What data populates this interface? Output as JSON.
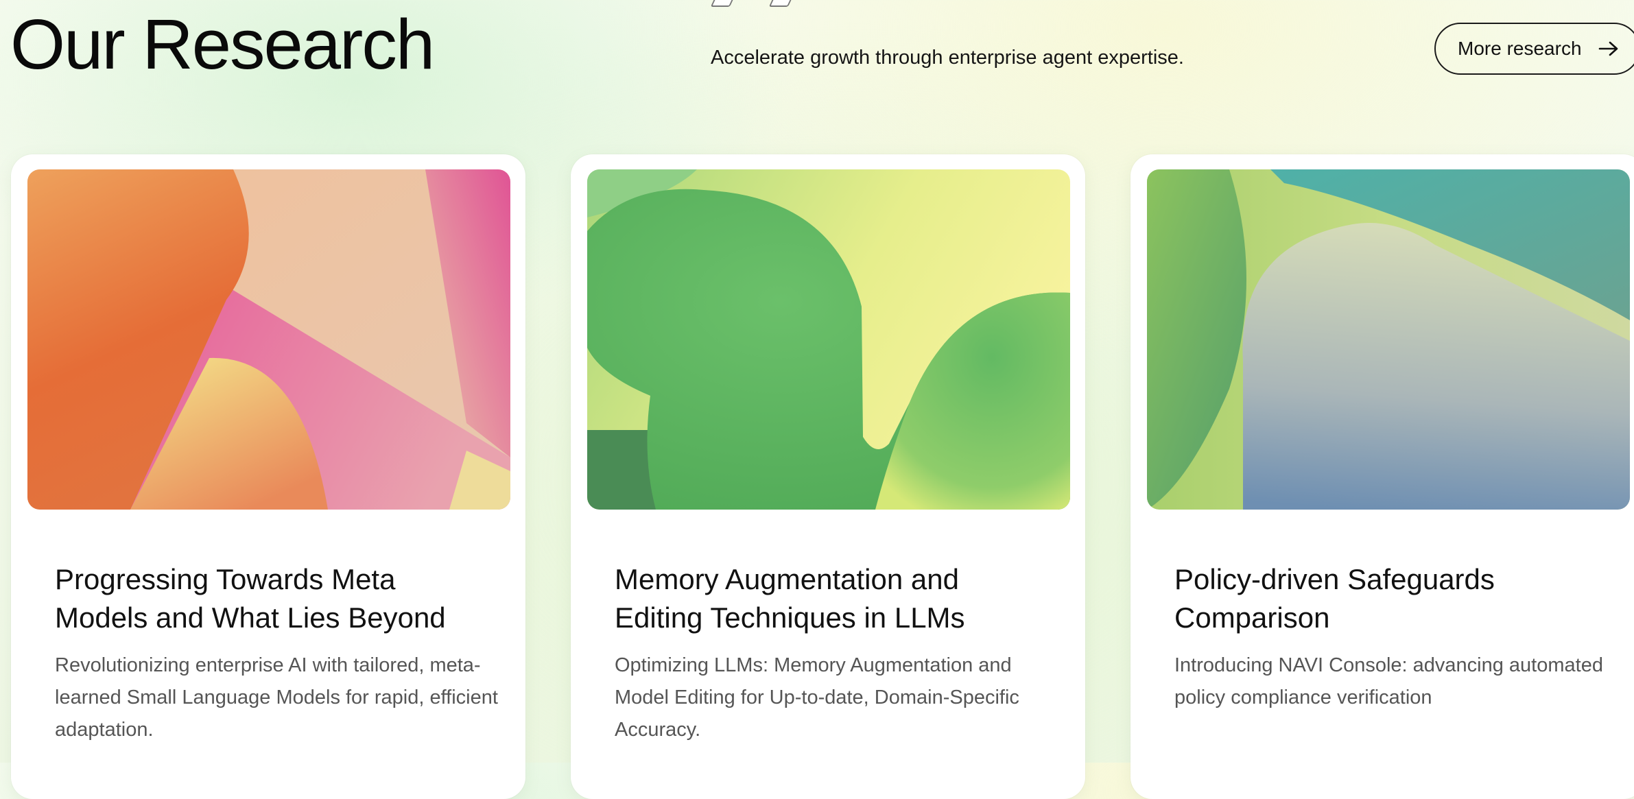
{
  "header": {
    "title": "Our Research",
    "subtitle": "Accelerate growth through enterprise agent expertise.",
    "more_button_label": "More research"
  },
  "cards": [
    {
      "title": "Progressing Towards Meta Models and What Lies Beyond",
      "description": "Revolutionizing enterprise AI with tailored, meta-learned Small Language Models for rapid, efficient adaptation.",
      "image_palette": [
        "#e9733d",
        "#e65b98",
        "#f3e58e"
      ]
    },
    {
      "title": "Memory Augmentation and Editing Techniques in LLMs",
      "description": "Optimizing LLMs: Memory Augmentation and Model Editing for Up-to-date, Domain-Specific Accuracy.",
      "image_palette": [
        "#5cb85e",
        "#c4e07a",
        "#f6f2a0"
      ]
    },
    {
      "title": "Policy-driven Safeguards Comparison",
      "description": "Introducing NAVI Console: advancing automated policy compliance verification",
      "image_palette": [
        "#8fc45e",
        "#4fa9a4",
        "#7b97b4"
      ]
    }
  ]
}
